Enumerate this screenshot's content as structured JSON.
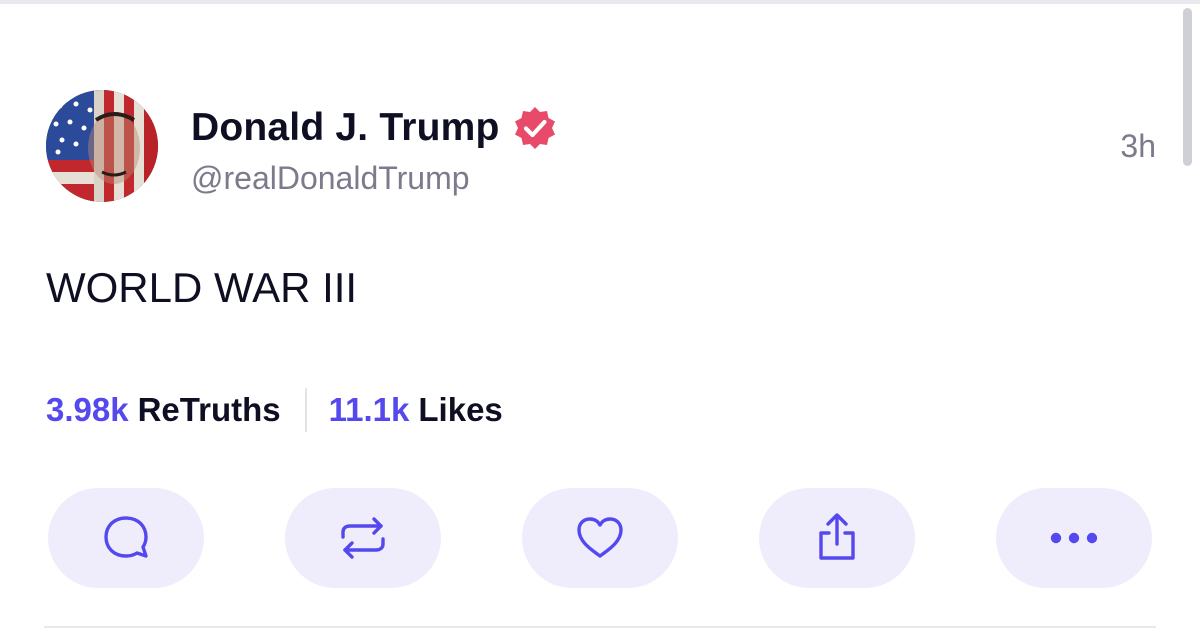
{
  "post": {
    "author": {
      "display_name": "Donald J. Trump",
      "handle": "@realDonaldTrump",
      "verified": true,
      "avatar_icon": "flag-portrait-avatar"
    },
    "timestamp": "3h",
    "text": "WORLD WAR III",
    "stats": {
      "retruths_count": "3.98k",
      "retruths_label": "ReTruths",
      "likes_count": "11.1k",
      "likes_label": "Likes"
    },
    "actions": [
      {
        "name": "reply",
        "icon": "comment-bubble-icon"
      },
      {
        "name": "retruth",
        "icon": "repost-arrows-icon"
      },
      {
        "name": "like",
        "icon": "heart-icon"
      },
      {
        "name": "share",
        "icon": "share-upload-icon"
      },
      {
        "name": "more",
        "icon": "more-dots-icon"
      }
    ]
  },
  "colors": {
    "accent": "#5448ee",
    "verified_badge": "#e84a6a",
    "button_bg": "#efedfb",
    "text_primary": "#0f0f23",
    "text_secondary": "#7b7b8c"
  }
}
